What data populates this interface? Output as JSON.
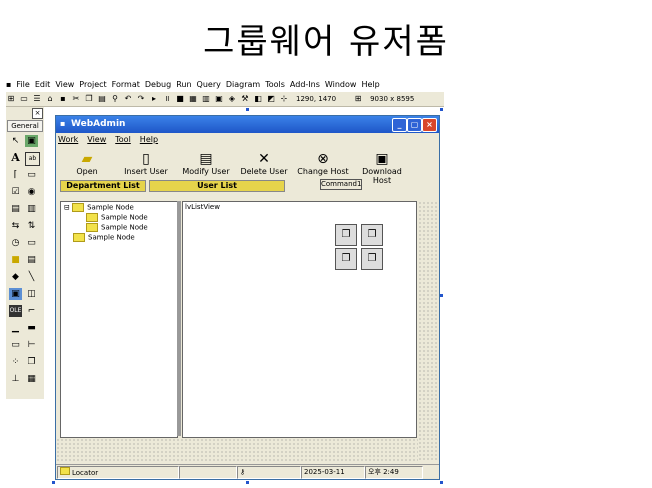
{
  "slide_title": "그룹웨어  유저폼",
  "ide": {
    "menus": [
      "File",
      "Edit",
      "View",
      "Project",
      "Format",
      "Debug",
      "Run",
      "Query",
      "Diagram",
      "Tools",
      "Add-Ins",
      "Window",
      "Help"
    ],
    "position_readout": "1290, 1470",
    "size_readout": "9030 x 8595",
    "toolbox_tab": "General"
  },
  "form": {
    "title": "WebAdmin",
    "menus": [
      "Work",
      "View",
      "Tool",
      "Help"
    ],
    "buttons": [
      "Open",
      "Insert User",
      "Modify User",
      "Delete User",
      "Change Host",
      "Download Host"
    ],
    "department_label": "Department List",
    "user_label": "User List",
    "command_label": "Command1",
    "tree_nodes": [
      "Sample Node",
      "Sample Node",
      "Sample Node",
      "Sample Node"
    ],
    "listview_label": "lvListView",
    "status": {
      "locator": "Locator",
      "date": "2025-03-11",
      "time": "오후 2:49"
    }
  }
}
